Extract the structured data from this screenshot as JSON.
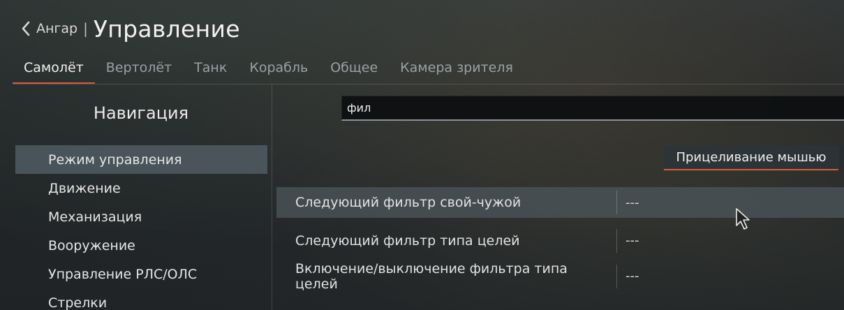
{
  "header": {
    "back_label": "Ангар",
    "separator": "|",
    "title": "Управление"
  },
  "tabs": [
    {
      "label": "Самолёт",
      "active": true
    },
    {
      "label": "Вертолёт",
      "active": false
    },
    {
      "label": "Танк",
      "active": false
    },
    {
      "label": "Корабль",
      "active": false
    },
    {
      "label": "Общее",
      "active": false
    },
    {
      "label": "Камера зрителя",
      "active": false
    }
  ],
  "sidebar": {
    "title": "Навигация",
    "items": [
      {
        "label": "Режим управления",
        "active": true
      },
      {
        "label": "Движение",
        "active": false
      },
      {
        "label": "Механизация",
        "active": false
      },
      {
        "label": "Вооружение",
        "active": false
      },
      {
        "label": "Управление РЛС/ОЛС",
        "active": false
      },
      {
        "label": "Стрелки",
        "active": false
      }
    ]
  },
  "search": {
    "value": "фил",
    "placeholder": ""
  },
  "preset_button": {
    "label": "Прицеливание мышью"
  },
  "bindings": [
    {
      "label": "Следующий фильтр свой-чужой",
      "value": "---",
      "highlight": true
    },
    {
      "label": "Следующий фильтр типа целей",
      "value": "---",
      "highlight": false
    },
    {
      "label": "Включение/выключение фильтра типа целей",
      "value": "---",
      "highlight": false
    }
  ],
  "colors": {
    "accent": "#d75b3c",
    "active_row": "#505c63",
    "background": "#2b2f31"
  },
  "icons": {
    "back": "chevron-left-icon",
    "cursor": "mouse-pointer-icon"
  }
}
